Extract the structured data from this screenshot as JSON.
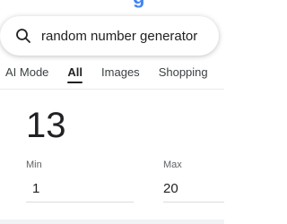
{
  "search": {
    "query": "random number generator",
    "icon": "search-icon"
  },
  "tabs": [
    {
      "label": "AI Mode"
    },
    {
      "label": "All"
    },
    {
      "label": "Images"
    },
    {
      "label": "Shopping"
    }
  ],
  "active_tab": "All",
  "generator": {
    "result": "13",
    "min_label": "Min",
    "min_value": "1",
    "max_label": "Max",
    "max_value": "20"
  },
  "colors": {
    "brand": "#4285f4",
    "text": "#202124",
    "muted": "#5f6368",
    "divider": "#dadce0"
  }
}
